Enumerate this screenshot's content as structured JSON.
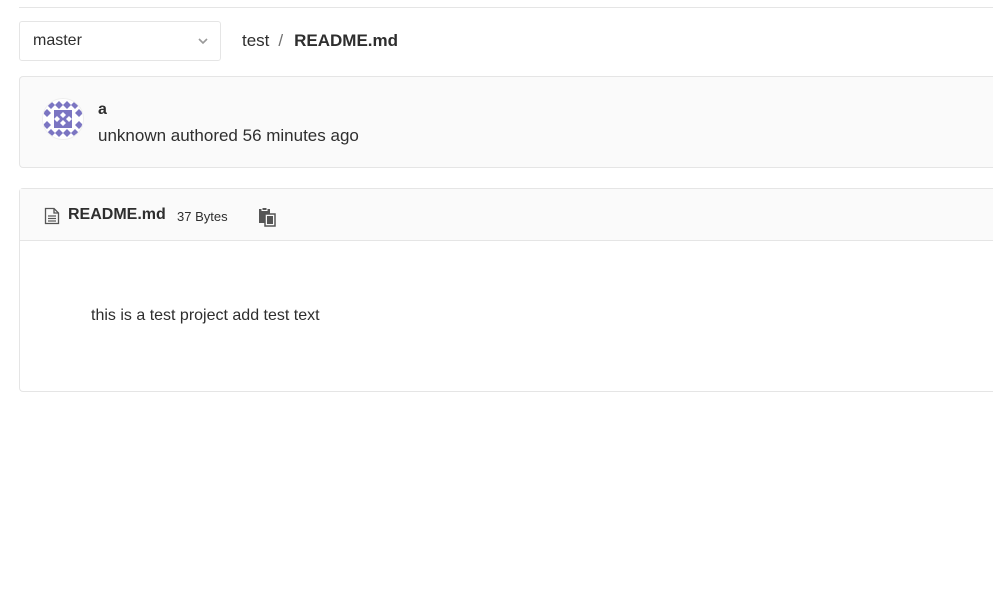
{
  "branch_selector": {
    "value": "master",
    "icon": "chevron-down-icon"
  },
  "breadcrumb": {
    "project": "test",
    "separator": "/",
    "current_file": "README.md"
  },
  "commit": {
    "title": "a",
    "author": "unknown",
    "meta_text": "unknown authored 56 minutes ago",
    "avatar_color": "#7b75c2"
  },
  "file": {
    "name": "README.md",
    "size": "37 Bytes",
    "file_icon": "file-text-icon",
    "copy_icon": "clipboard-icon",
    "content": "this is a test project add test text"
  },
  "colors": {
    "border": "#e5e5e5",
    "panel_bg": "#fafafa",
    "text": "#2e2e2e",
    "icon": "#555555"
  }
}
